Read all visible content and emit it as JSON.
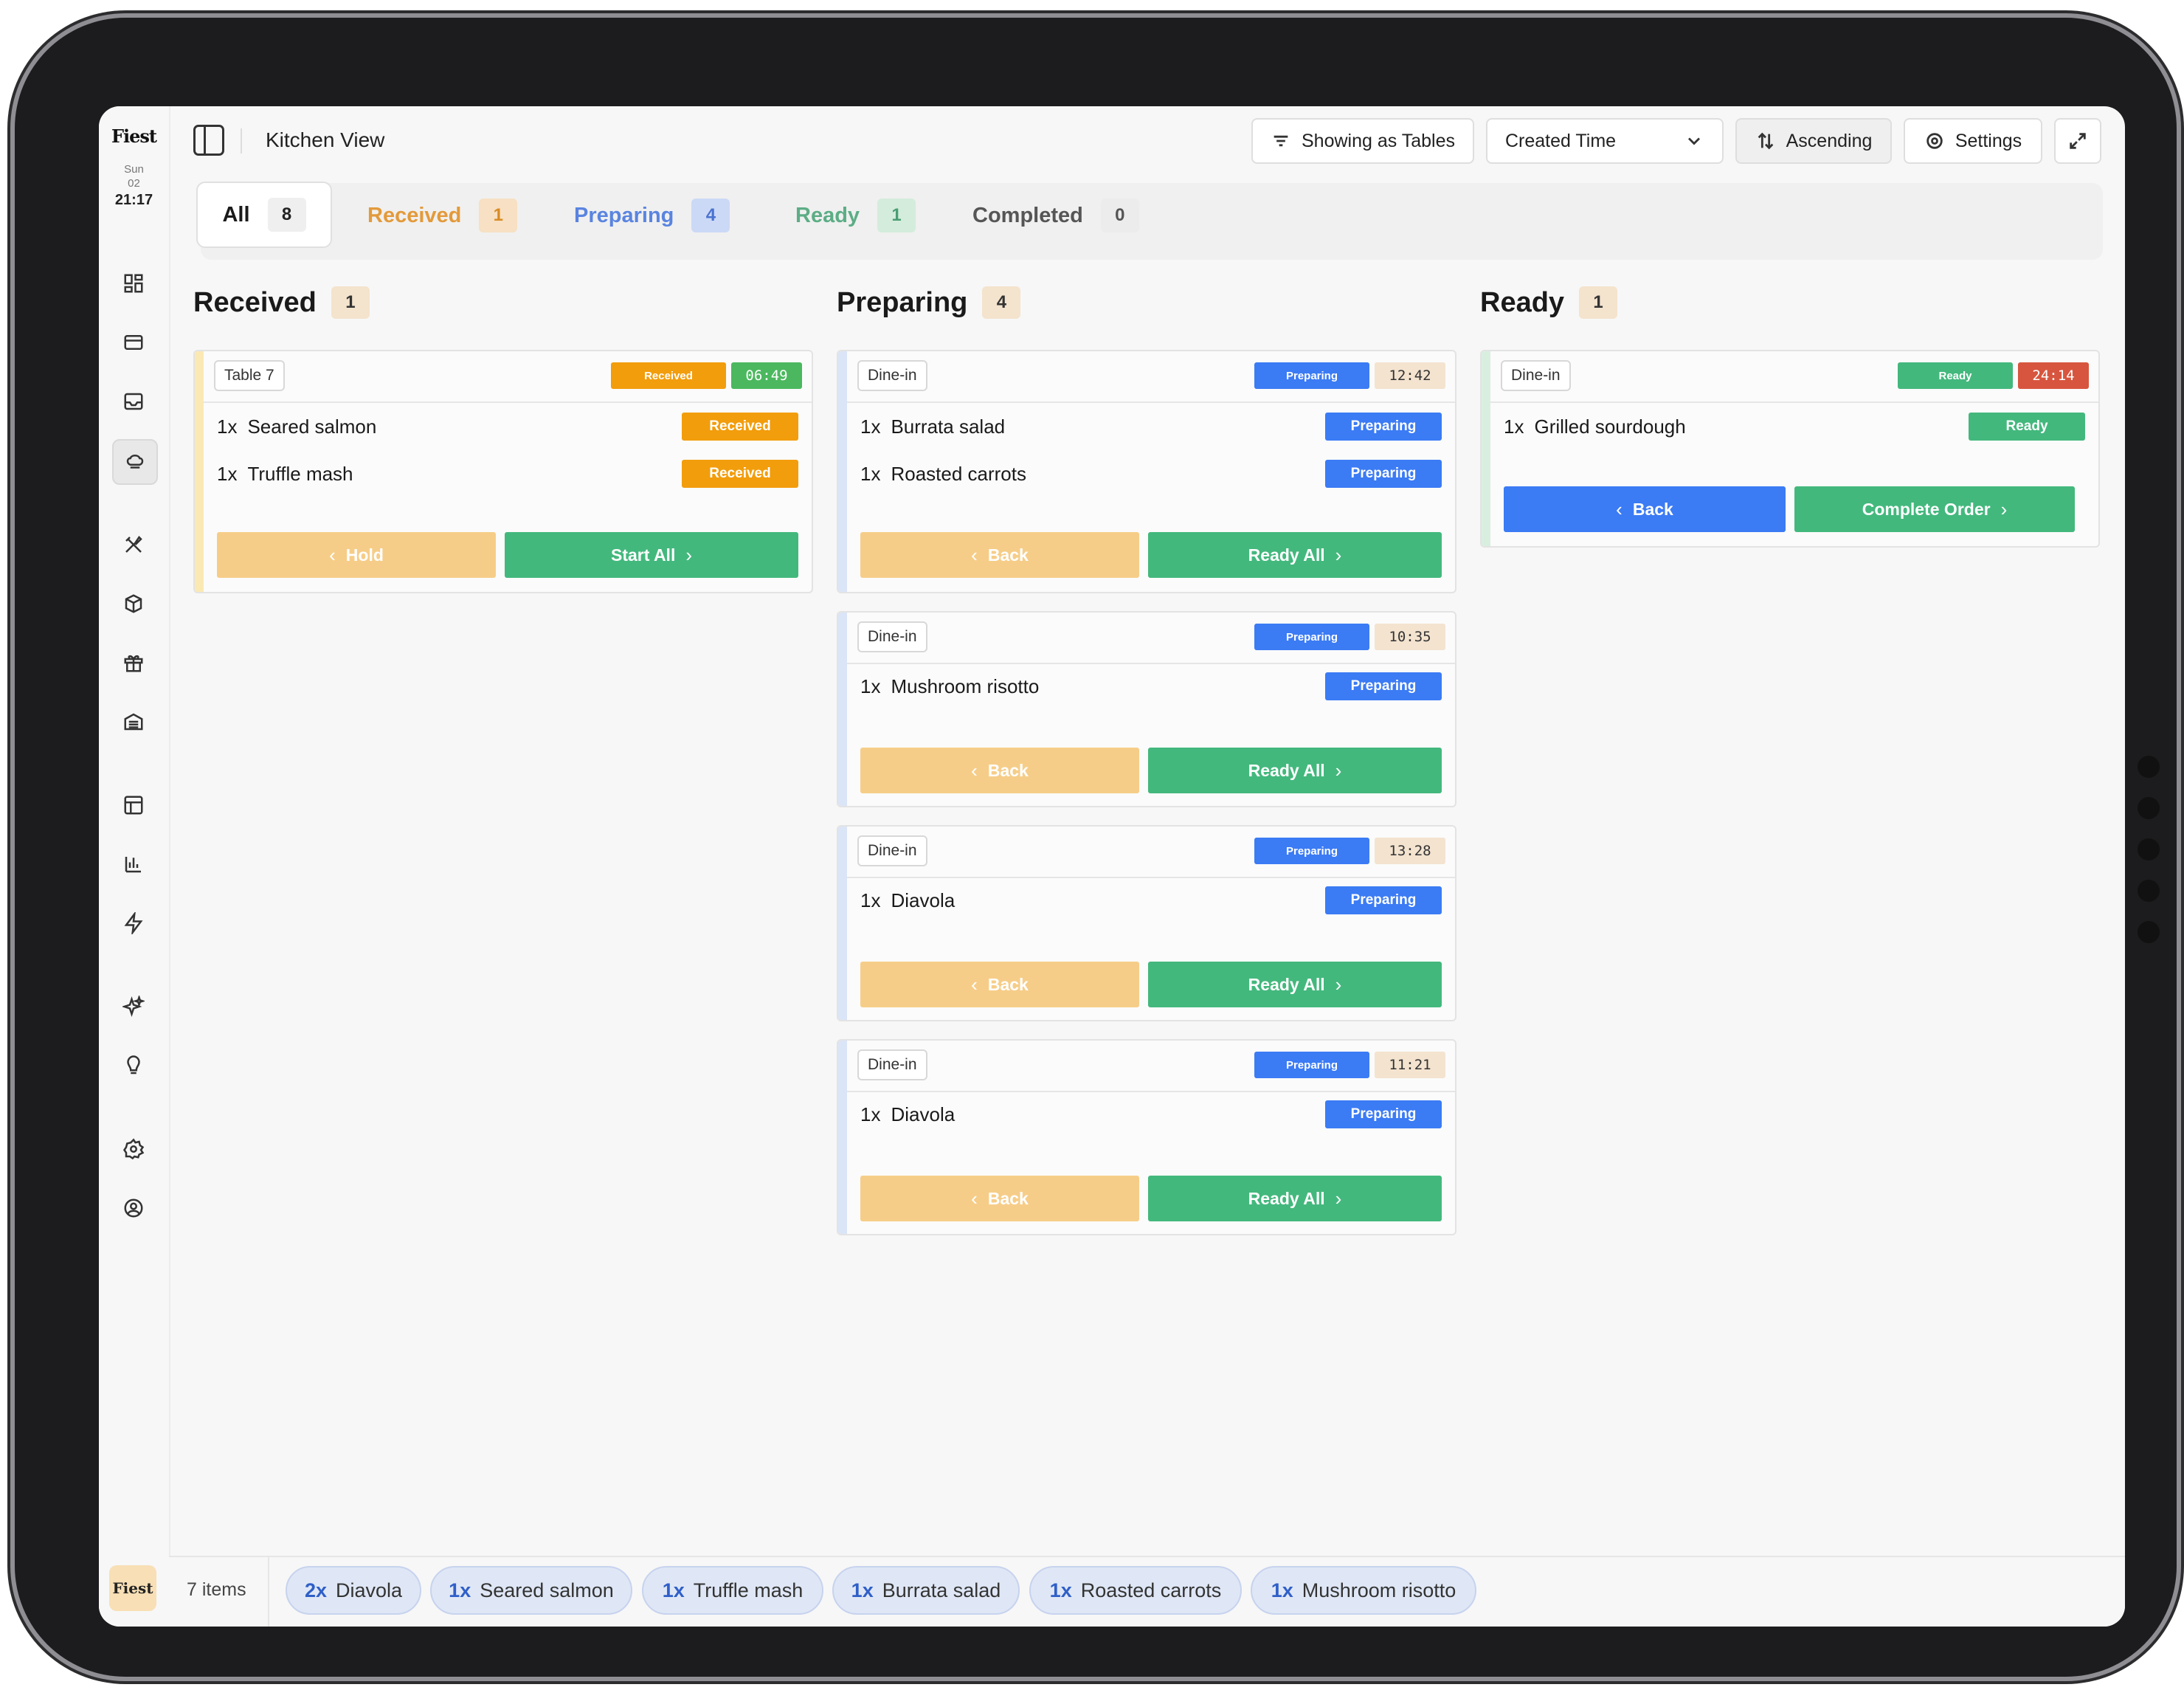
{
  "brand": {
    "logo": "Fiest",
    "day": "Sun",
    "date": "02",
    "time": "21:17"
  },
  "header": {
    "title": "Kitchen View",
    "view_mode": "Showing as Tables",
    "sort_field": "Created Time",
    "sort_order": "Ascending",
    "settings": "Settings"
  },
  "tabs": [
    {
      "label": "All",
      "count": "8"
    },
    {
      "label": "Received",
      "count": "1"
    },
    {
      "label": "Preparing",
      "count": "4"
    },
    {
      "label": "Ready",
      "count": "1"
    },
    {
      "label": "Completed",
      "count": "0"
    }
  ],
  "columns": {
    "received": {
      "title": "Received",
      "count": "1"
    },
    "preparing": {
      "title": "Preparing",
      "count": "4"
    },
    "ready": {
      "title": "Ready",
      "count": "1"
    }
  },
  "orders": {
    "received_1": {
      "tag": "Table 7",
      "status": "Received",
      "timer": "06:49",
      "items": [
        {
          "qty": "1x",
          "name": "Seared salmon",
          "status": "Received"
        },
        {
          "qty": "1x",
          "name": "Truffle mash",
          "status": "Received"
        }
      ],
      "back_label": "Hold",
      "forward_label": "Start All"
    },
    "preparing_1": {
      "tag": "Dine-in",
      "status": "Preparing",
      "timer": "12:42",
      "items": [
        {
          "qty": "1x",
          "name": "Burrata salad",
          "status": "Preparing"
        },
        {
          "qty": "1x",
          "name": "Roasted carrots",
          "status": "Preparing"
        }
      ],
      "back_label": "Back",
      "forward_label": "Ready All"
    },
    "preparing_2": {
      "tag": "Dine-in",
      "status": "Preparing",
      "timer": "10:35",
      "items": [
        {
          "qty": "1x",
          "name": "Mushroom risotto",
          "status": "Preparing"
        }
      ],
      "back_label": "Back",
      "forward_label": "Ready All"
    },
    "preparing_3": {
      "tag": "Dine-in",
      "status": "Preparing",
      "timer": "13:28",
      "items": [
        {
          "qty": "1x",
          "name": "Diavola",
          "status": "Preparing"
        }
      ],
      "back_label": "Back",
      "forward_label": "Ready All"
    },
    "preparing_4": {
      "tag": "Dine-in",
      "status": "Preparing",
      "timer": "11:21",
      "items": [
        {
          "qty": "1x",
          "name": "Diavola",
          "status": "Preparing"
        }
      ],
      "back_label": "Back",
      "forward_label": "Ready All"
    },
    "ready_1": {
      "tag": "Dine-in",
      "status": "Ready",
      "timer": "24:14",
      "items": [
        {
          "qty": "1x",
          "name": "Grilled sourdough",
          "status": "Ready"
        }
      ],
      "back_label": "Back",
      "forward_label": "Complete Order"
    }
  },
  "summary": {
    "items_label": "7 items",
    "chips": [
      {
        "qty": "2x",
        "name": "Diavola"
      },
      {
        "qty": "1x",
        "name": "Seared salmon"
      },
      {
        "qty": "1x",
        "name": "Truffle mash"
      },
      {
        "qty": "1x",
        "name": "Burrata salad"
      },
      {
        "qty": "1x",
        "name": "Roasted carrots"
      },
      {
        "qty": "1x",
        "name": "Mushroom risotto"
      }
    ]
  },
  "colors": {
    "received": "#f29d0c",
    "preparing": "#3b7bf4",
    "ready": "#43b87d",
    "overdue_timer": "#d7553e",
    "hold_button": "#f6cd88"
  },
  "rail_icons": [
    "dashboard-icon",
    "card-icon",
    "inbox-icon",
    "chef-hat-icon",
    "utensils-icon",
    "box-icon",
    "gift-icon",
    "archive-icon",
    "table-icon",
    "chart-icon",
    "bolt-icon",
    "sparkles-icon",
    "lightbulb-icon",
    "settings-icon",
    "user-icon"
  ]
}
